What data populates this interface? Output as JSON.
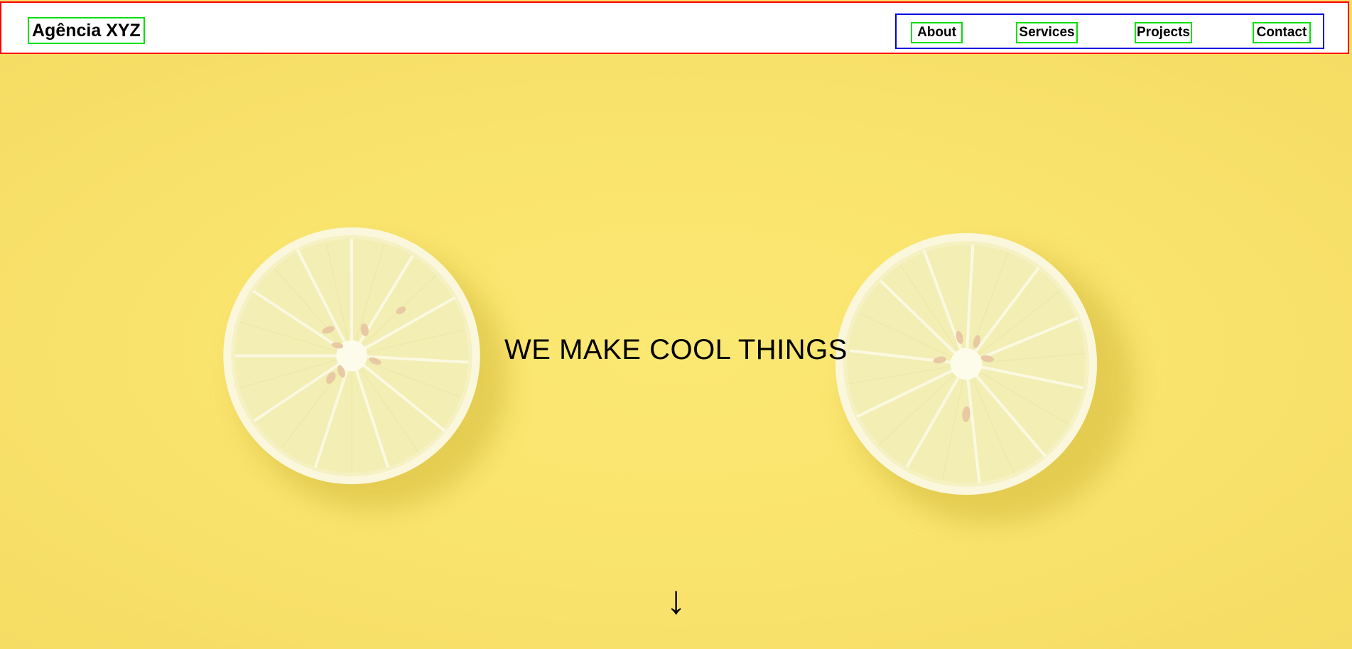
{
  "header": {
    "brand": "Agência XYZ",
    "nav": [
      {
        "label": "About"
      },
      {
        "label": "Services"
      },
      {
        "label": "Projects"
      },
      {
        "label": "Contact"
      }
    ]
  },
  "hero": {
    "title": "WE MAKE COOL THINGS",
    "scroll_icon": "↓"
  },
  "colors": {
    "background": "#f9e36d",
    "lemon_rind": "#fbf6d8",
    "lemon_pulp": "#f1eeb0",
    "text": "#000000"
  }
}
